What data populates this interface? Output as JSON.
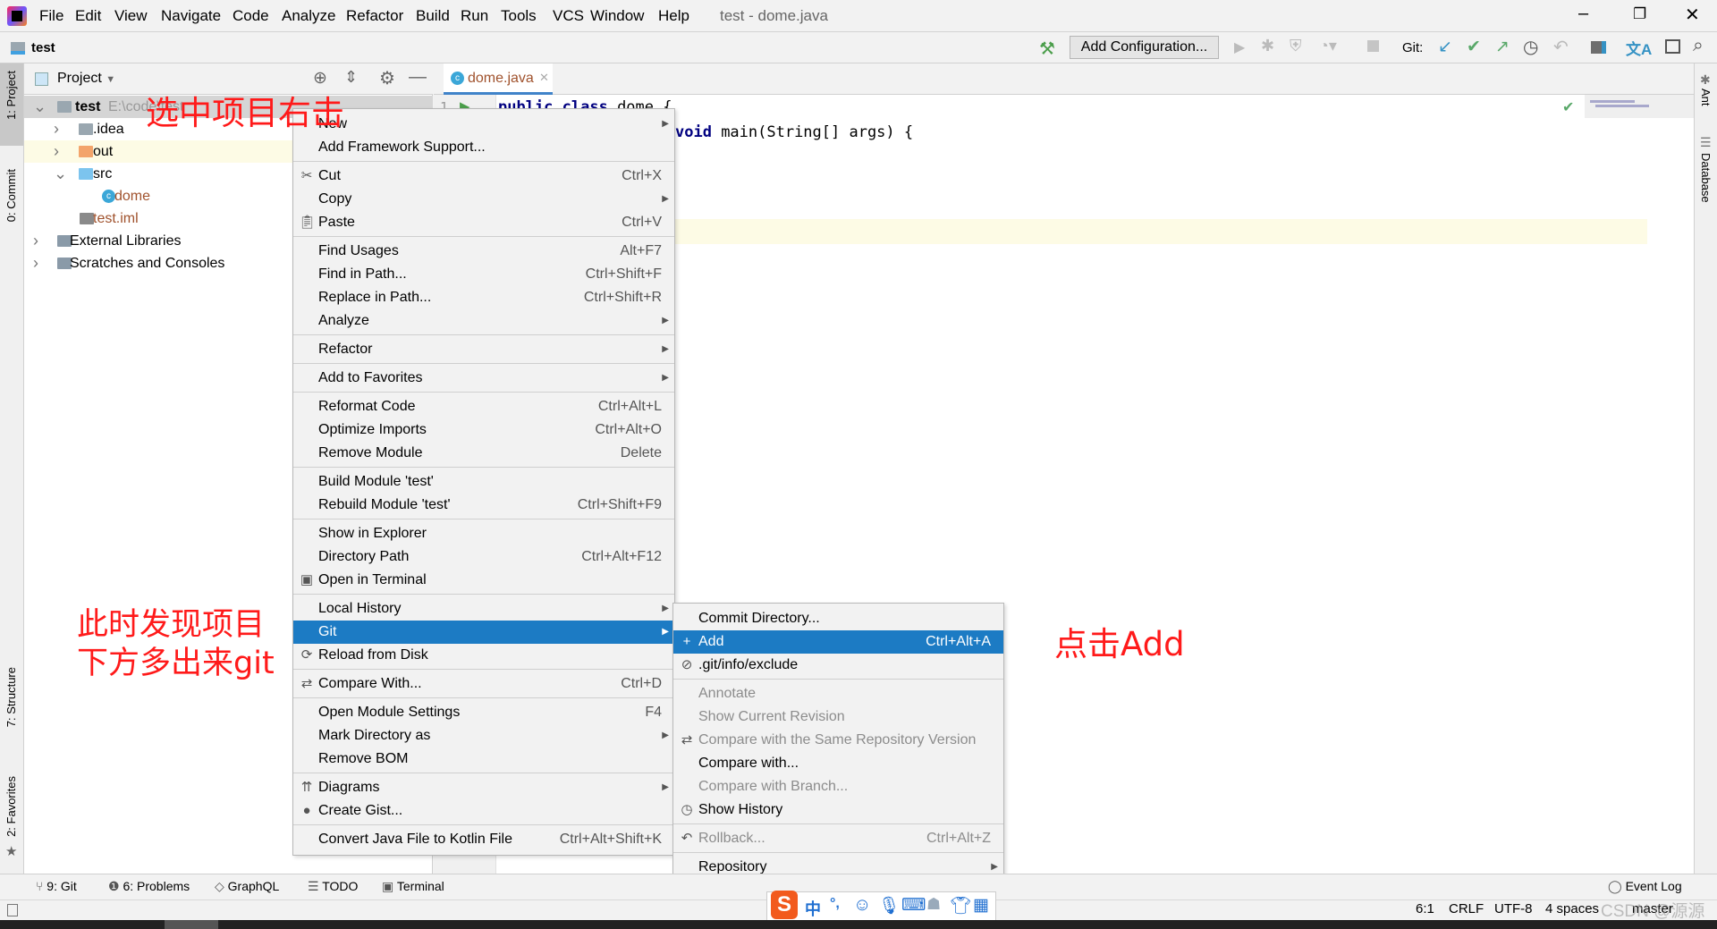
{
  "window": {
    "title": "test - dome.java",
    "controls": [
      "minimize",
      "restore",
      "close"
    ]
  },
  "menubar": [
    "File",
    "Edit",
    "View",
    "Navigate",
    "Code",
    "Analyze",
    "Refactor",
    "Build",
    "Run",
    "Tools",
    "VCS",
    "Window",
    "Help"
  ],
  "navbar": {
    "project": "test",
    "add_configuration": "Add Configuration...",
    "git_label": "Git:"
  },
  "left_stripe": {
    "project": "1: Project",
    "commit": "0: Commit",
    "structure": "7: Structure",
    "favorites": "2: Favorites"
  },
  "right_stripe": {
    "ant": "Ant",
    "database": "Database"
  },
  "project_panel": {
    "title": "Project",
    "tree": [
      {
        "label": "test",
        "extra": "E:\\code\\test",
        "icon": "module-folder-icon",
        "selected": true
      },
      {
        "label": ".idea",
        "icon": "folder-icon"
      },
      {
        "label": "out",
        "icon": "excluded-folder-icon",
        "color": "#f3a46b"
      },
      {
        "label": "src",
        "icon": "source-folder-icon"
      },
      {
        "label": "dome",
        "icon": "java-class-icon"
      },
      {
        "label": "test.iml",
        "icon": "iml-file-icon"
      },
      {
        "label": "External Libraries",
        "icon": "libraries-icon"
      },
      {
        "label": "Scratches and Consoles",
        "icon": "scratches-icon"
      }
    ]
  },
  "editor": {
    "tab": "dome.java",
    "line_number": "1",
    "line1_kw": "public class",
    "line1_rest": " dome {",
    "line2_kw": "void",
    "line2_rest": " main(String[] args) {"
  },
  "context_menu": {
    "items": [
      {
        "label": "New",
        "submenu": true
      },
      {
        "label": "Add Framework Support..."
      },
      {
        "sep": true
      },
      {
        "label": "Cut",
        "shortcut": "Ctrl+X",
        "icon": "cut-icon"
      },
      {
        "label": "Copy",
        "submenu": true
      },
      {
        "label": "Paste",
        "shortcut": "Ctrl+V",
        "icon": "paste-icon"
      },
      {
        "sep": true
      },
      {
        "label": "Find Usages",
        "shortcut": "Alt+F7"
      },
      {
        "label": "Find in Path...",
        "shortcut": "Ctrl+Shift+F"
      },
      {
        "label": "Replace in Path...",
        "shortcut": "Ctrl+Shift+R"
      },
      {
        "label": "Analyze",
        "submenu": true
      },
      {
        "sep": true
      },
      {
        "label": "Refactor",
        "submenu": true
      },
      {
        "sep": true
      },
      {
        "label": "Add to Favorites",
        "submenu": true
      },
      {
        "sep": true
      },
      {
        "label": "Reformat Code",
        "shortcut": "Ctrl+Alt+L"
      },
      {
        "label": "Optimize Imports",
        "shortcut": "Ctrl+Alt+O"
      },
      {
        "label": "Remove Module",
        "shortcut": "Delete"
      },
      {
        "sep": true
      },
      {
        "label": "Build Module 'test'"
      },
      {
        "label": "Rebuild Module 'test'",
        "shortcut": "Ctrl+Shift+F9"
      },
      {
        "sep": true
      },
      {
        "label": "Show in Explorer"
      },
      {
        "label": "Directory Path",
        "shortcut": "Ctrl+Alt+F12"
      },
      {
        "label": "Open in Terminal",
        "icon": "terminal-icon"
      },
      {
        "sep": true
      },
      {
        "label": "Local History",
        "submenu": true
      },
      {
        "label": "Git",
        "submenu": true,
        "selected": true
      },
      {
        "label": "Reload from Disk",
        "icon": "reload-icon"
      },
      {
        "sep": true
      },
      {
        "label": "Compare With...",
        "shortcut": "Ctrl+D",
        "icon": "compare-icon"
      },
      {
        "sep": true
      },
      {
        "label": "Open Module Settings",
        "shortcut": "F4"
      },
      {
        "label": "Mark Directory as",
        "submenu": true
      },
      {
        "label": "Remove BOM"
      },
      {
        "sep": true
      },
      {
        "label": "Diagrams",
        "submenu": true,
        "icon": "diagram-icon"
      },
      {
        "label": "Create Gist...",
        "icon": "github-icon"
      },
      {
        "sep": true
      },
      {
        "label": "Convert Java File to Kotlin File",
        "shortcut": "Ctrl+Alt+Shift+K"
      }
    ]
  },
  "git_menu": {
    "items": [
      {
        "label": "Commit Directory..."
      },
      {
        "label": "Add",
        "shortcut": "Ctrl+Alt+A",
        "icon": "plus-icon",
        "selected": true
      },
      {
        "label": ".git/info/exclude",
        "icon": "ignore-file-icon"
      },
      {
        "sep": true
      },
      {
        "label": "Annotate",
        "disabled": true
      },
      {
        "label": "Show Current Revision",
        "disabled": true
      },
      {
        "label": "Compare with the Same Repository Version",
        "disabled": true,
        "icon": "compare-icon"
      },
      {
        "label": "Compare with..."
      },
      {
        "label": "Compare with Branch...",
        "disabled": true
      },
      {
        "label": "Show History",
        "icon": "history-icon"
      },
      {
        "sep": true
      },
      {
        "label": "Rollback...",
        "shortcut": "Ctrl+Alt+Z",
        "disabled": true,
        "icon": "rollback-icon"
      },
      {
        "sep": true
      },
      {
        "label": "Repository",
        "submenu": true
      }
    ]
  },
  "annotations": {
    "right_click": "选中项目右击",
    "git_appears_1": "此时发现项目",
    "git_appears_2": "下方多出来git",
    "click_add": "点击Add",
    "color": "#ff1a1a"
  },
  "bottom_tools": [
    {
      "label": "9: Git"
    },
    {
      "label": "6: Problems"
    },
    {
      "label": "GraphQL"
    },
    {
      "label": "TODO"
    },
    {
      "label": "Terminal"
    }
  ],
  "event_log": "Event Log",
  "status": {
    "position": "6:1",
    "line_sep": "CRLF",
    "encoding": "UTF-8",
    "indent": "4 spaces",
    "branch": "master"
  },
  "ime": {
    "mode": "中",
    "punct": "°,"
  },
  "watermark": "CSDN @源源",
  "colors": {
    "selection": "#1c7bc4",
    "annotation": "#ff1a1a",
    "keyword": "#000080"
  }
}
